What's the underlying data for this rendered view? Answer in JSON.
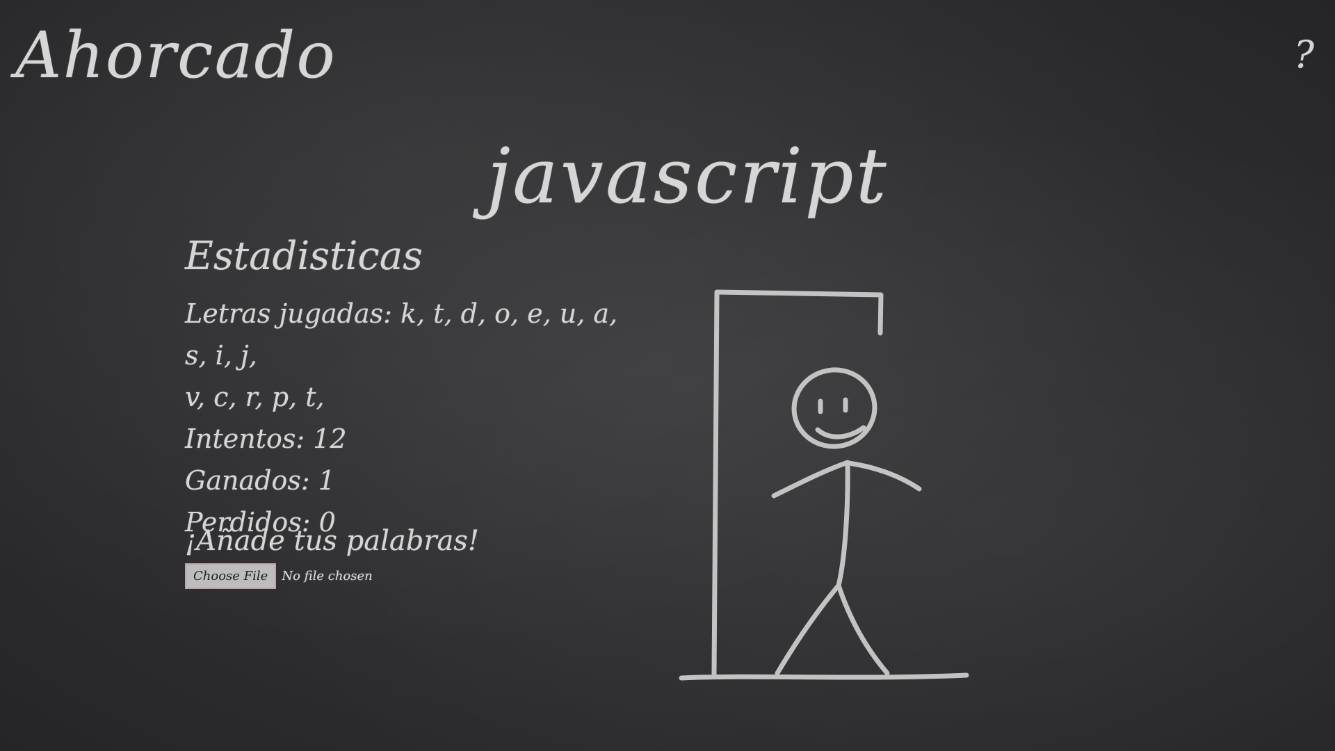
{
  "header": {
    "title": "Ahorcado",
    "help": "?"
  },
  "game": {
    "word": "javascript"
  },
  "stats": {
    "heading": "Estadisticas",
    "played_letters_line_1": "Letras jugadas: k, t, d, o, e, u, a, s, i, j,",
    "played_letters_line_2": "v, c, r, p, t,",
    "attempts_text": "Intentos: 12",
    "won_text": "Ganados: 1",
    "lost_text": "Perdidos: 0"
  },
  "upload": {
    "title": "¡Añade tus palabras!",
    "button_label": "Choose File",
    "status": "No file chosen"
  },
  "icons": {
    "hangman": "hangman-drawing-icon",
    "help": "help-icon"
  }
}
